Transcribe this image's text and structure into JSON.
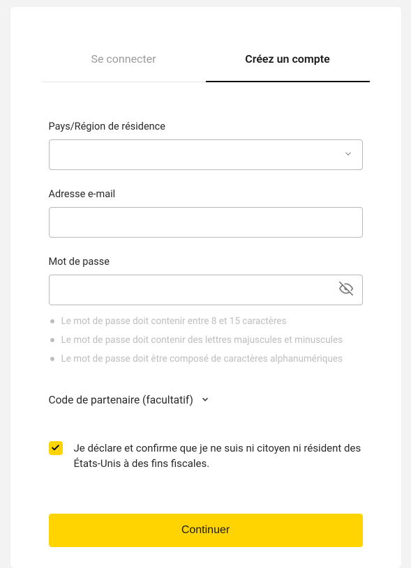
{
  "tabs": {
    "login": "Se connecter",
    "signup": "Créez un compte"
  },
  "fields": {
    "country": {
      "label": "Pays/Région de résidence",
      "value": ""
    },
    "email": {
      "label": "Adresse e-mail",
      "value": ""
    },
    "password": {
      "label": "Mot de passe",
      "value": ""
    }
  },
  "password_hints": [
    "Le mot de passe doit contenir entre 8 et 15 caractères",
    "Le mot de passe doit contenir des lettres majuscules et minuscules",
    "Le mot de passe doit être composé de caractères alphanumériques"
  ],
  "partner": {
    "label": "Code de partenaire (facultatif)"
  },
  "declaration": {
    "checked": true,
    "text": "Je déclare et confirme que je ne suis ni citoyen ni résident des États-Unis à des fins fiscales."
  },
  "submit": {
    "label": "Continuer"
  },
  "colors": {
    "accent": "#FFD400"
  }
}
